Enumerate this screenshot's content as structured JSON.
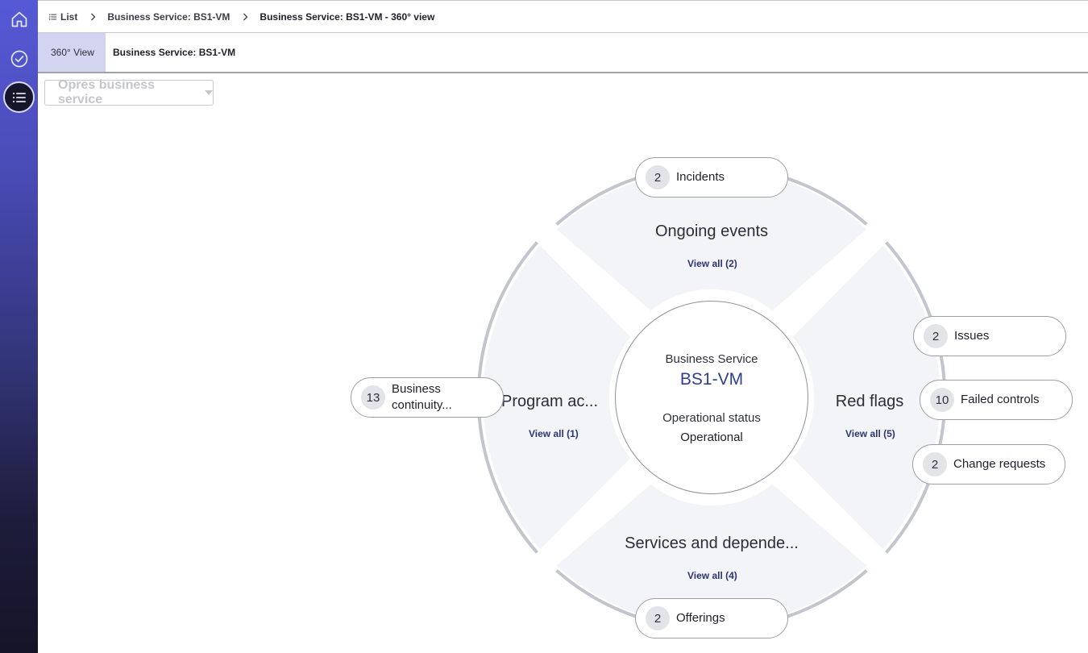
{
  "breadcrumb": {
    "list_label": "List",
    "parent_label": "Business Service: BS1-VM",
    "current_label": "Business Service: BS1-VM - 360° view"
  },
  "tabs": {
    "view_label": "360° View",
    "record_label": "Business Service: BS1-VM"
  },
  "selector": {
    "label": "Opres business service"
  },
  "hub": {
    "type": "Business Service",
    "name": "BS1-VM",
    "status_label": "Operational status",
    "status_value": "Operational"
  },
  "segments": {
    "top": {
      "title": "Ongoing events",
      "view_all": "View all (2)"
    },
    "right": {
      "title": "Red flags",
      "view_all": "View all (5)"
    },
    "bottom": {
      "title": "Services and depende...",
      "view_all": "View all (4)"
    },
    "left": {
      "title": "Program ac...",
      "view_all": "View all (1)"
    }
  },
  "pills": {
    "incidents": {
      "count": "2",
      "label": "Incidents"
    },
    "issues": {
      "count": "2",
      "label": "Issues"
    },
    "failed_controls": {
      "count": "10",
      "label": "Failed controls"
    },
    "change_requests": {
      "count": "2",
      "label": "Change requests"
    },
    "offerings": {
      "count": "2",
      "label": "Offerings"
    },
    "business_continuity": {
      "count": "13",
      "label": "Business continuity..."
    }
  },
  "colors": {
    "rail_top": "#5659d6",
    "rail_bottom": "#151428",
    "segment_fill": "#f3f4f7",
    "ring": "#c2c5cd",
    "link": "#2c3473",
    "hub_name": "#2f3f8f"
  }
}
